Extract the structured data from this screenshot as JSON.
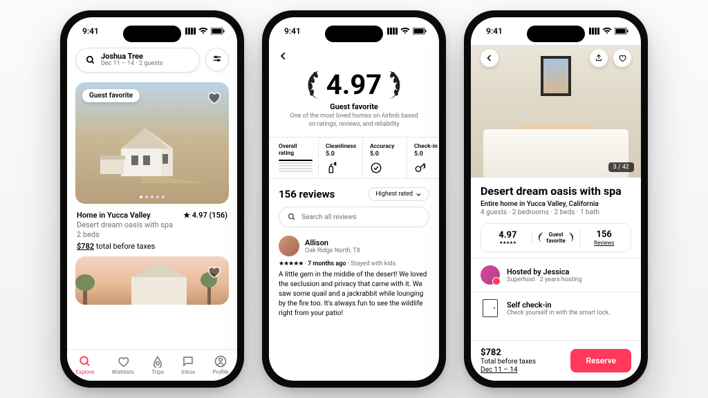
{
  "status": {
    "time": "9:41"
  },
  "p1": {
    "search": {
      "location": "Joshua Tree",
      "details": "Dec 11 – 14 · 2 guests"
    },
    "card": {
      "badge": "Guest favorite",
      "title": "Home in Yucca Valley",
      "rating": "★ 4.97 (156)",
      "subtitle": "Desert dream oasis with spa",
      "beds": "2 beds",
      "price_amount": "$782",
      "price_suffix": " total before taxes"
    },
    "tabs": {
      "explore": "Explore",
      "wishlists": "Wishlists",
      "trips": "Trips",
      "inbox": "Inbox",
      "profile": "Profile"
    }
  },
  "p2": {
    "rating": "4.97",
    "gf_title": "Guest favorite",
    "gf_sub": "One of the most loved homes on Airbnb based on ratings, reviews, and reliability",
    "scores": {
      "overall_lbl": "Overall rating",
      "clean_lbl": "Cleanliness",
      "clean_val": "5.0",
      "acc_lbl": "Accuracy",
      "acc_val": "5.0",
      "check_lbl": "Check-in",
      "check_val": "5.0"
    },
    "reviews_header": "156 reviews",
    "sort": "Highest rated",
    "search_placeholder": "Search all reviews",
    "review": {
      "name": "Allison",
      "loc": "Oak Ridge North, TX",
      "stars": "★★★★★",
      "time": "7 months ago",
      "stay": "Stayed with kids",
      "text": "A little gem in the middle of the desert! We loved the seclusion and privacy that came with it. We saw some quail and a jackrabbit while lounging by the fire too. It's always fun to see the wildlife right from your patio!"
    }
  },
  "p3": {
    "photo_count": "3 / 42",
    "title": "Desert dream oasis with spa",
    "location": "Entire home in Yucca Valley, California",
    "specs": "4 guests · 2 bedrooms · 2 beds · 1 bath",
    "rating_val": "4.97",
    "rating_stars": "★★★★★",
    "gf_label_l1": "Guest",
    "gf_label_l2": "favorite",
    "reviews_count": "156",
    "reviews_lbl": "Reviews",
    "host_line": "Hosted by Jessica",
    "host_meta": "Superhost · 2 years hosting",
    "checkin_t": "Self check-in",
    "checkin_s": "Check yourself in with the smart lock.",
    "price": "$782",
    "price_sub": "Total before taxes",
    "dates": "Dec 11 – 14",
    "reserve": "Reserve"
  }
}
